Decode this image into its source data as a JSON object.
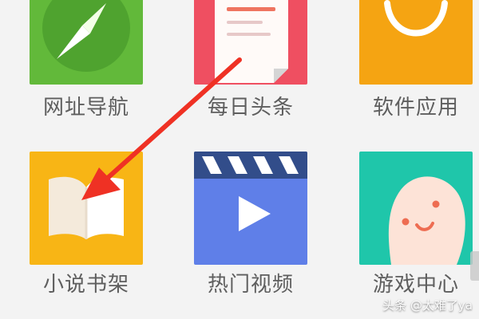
{
  "apps": [
    {
      "label": "网址导航",
      "icon": "compass-icon",
      "color": "#62b93a"
    },
    {
      "label": "每日头条",
      "icon": "newspaper-icon",
      "color": "#ef4f61"
    },
    {
      "label": "软件应用",
      "icon": "shopping-bag-icon",
      "color": "#f5a412"
    },
    {
      "label": "小说书架",
      "icon": "book-icon",
      "color": "#f8b515"
    },
    {
      "label": "热门视频",
      "icon": "clapperboard-icon",
      "color": "#5f7fe8"
    },
    {
      "label": "游戏中心",
      "icon": "smiley-character-icon",
      "color": "#1fc6aa"
    }
  ],
  "overlay": {
    "arrow_color": "#ef3124",
    "watermark": "头条 @太难了ya"
  }
}
